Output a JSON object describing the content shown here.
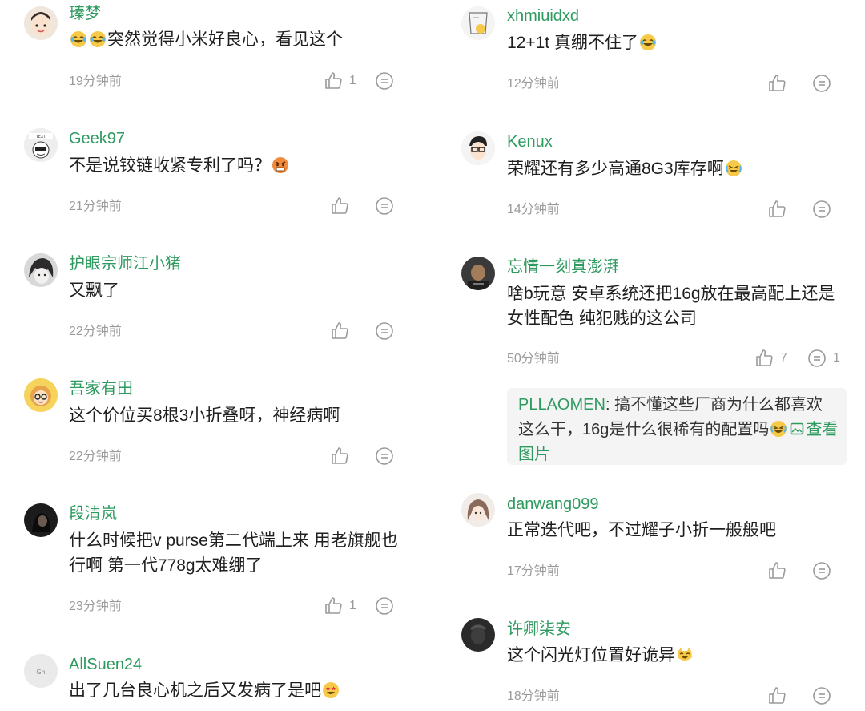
{
  "left": [
    {
      "username": "瑧梦",
      "time": "19分钟前",
      "likes": "1",
      "text": "突然觉得小米好良心，看见这个",
      "emoji_prefix": [
        "laugh-cry-emoji",
        "laugh-cry-emoji"
      ],
      "emoji_suffix": []
    },
    {
      "username": "Geek97",
      "time": "21分钟前",
      "likes": "",
      "text": "不是说铰链收紧专利了吗？",
      "emoji_prefix": [],
      "emoji_suffix": [
        "angry-face-emoji"
      ]
    },
    {
      "username": "护眼宗师江小猪",
      "time": "22分钟前",
      "likes": "",
      "text": "又飘了",
      "emoji_prefix": [],
      "emoji_suffix": []
    },
    {
      "username": "吾家有田",
      "time": "22分钟前",
      "likes": "",
      "text": "这个价位买8根3小折叠呀，神经病啊",
      "emoji_prefix": [],
      "emoji_suffix": []
    },
    {
      "username": "段清岚",
      "time": "23分钟前",
      "likes": "1",
      "text": "什么时候把v purse第二代端上来 用老旗舰也行啊 第一代778g太难绷了",
      "emoji_prefix": [],
      "emoji_suffix": []
    },
    {
      "username": "AllSuen24",
      "time": "",
      "likes": "",
      "text": "出了几台良心机之后又发病了是吧",
      "emoji_prefix": [],
      "emoji_suffix": [
        "starstruck-emoji"
      ]
    }
  ],
  "right": [
    {
      "username": "xhmiuidxd",
      "time": "12分钟前",
      "likes": "",
      "text": "12+1t 真绷不住了",
      "emoji_prefix": [],
      "emoji_suffix": [
        "laugh-cry-emoji"
      ]
    },
    {
      "username": "Kenux",
      "time": "14分钟前",
      "likes": "",
      "text": "荣耀还有多少高通8G3库存啊",
      "emoji_prefix": [],
      "emoji_suffix": [
        "crying-laugh-emoji"
      ]
    },
    {
      "username": "忘情一刻真澎湃",
      "time": "50分钟前",
      "likes": "7",
      "replies": "1",
      "text": "啥b玩意 安卓系统还把16g放在最高配上还是女性配色 纯犯贱的这公司",
      "emoji_prefix": [],
      "emoji_suffix": []
    },
    {
      "username": "danwang099",
      "time": "17分钟前",
      "likes": "",
      "text": "正常迭代吧，不过耀子小折一般般吧",
      "emoji_prefix": [],
      "emoji_suffix": []
    },
    {
      "username": "许卿柒安",
      "time": "18分钟前",
      "likes": "",
      "text": "这个闪光灯位置好诡异",
      "emoji_prefix": [],
      "emoji_suffix": [
        "cat-laugh-emoji"
      ]
    }
  ],
  "reply": {
    "user": "PLLAOMEN",
    "sep": ": ",
    "text": "搞不懂这些厂商为什么都喜欢这么干，16g是什么很稀有的配置吗",
    "link": "查看图片"
  },
  "colors": {
    "username": "#2e9a5f",
    "text": "#1f1f1f",
    "meta": "#9a9a9a",
    "reply_bg": "#f4f4f4"
  }
}
